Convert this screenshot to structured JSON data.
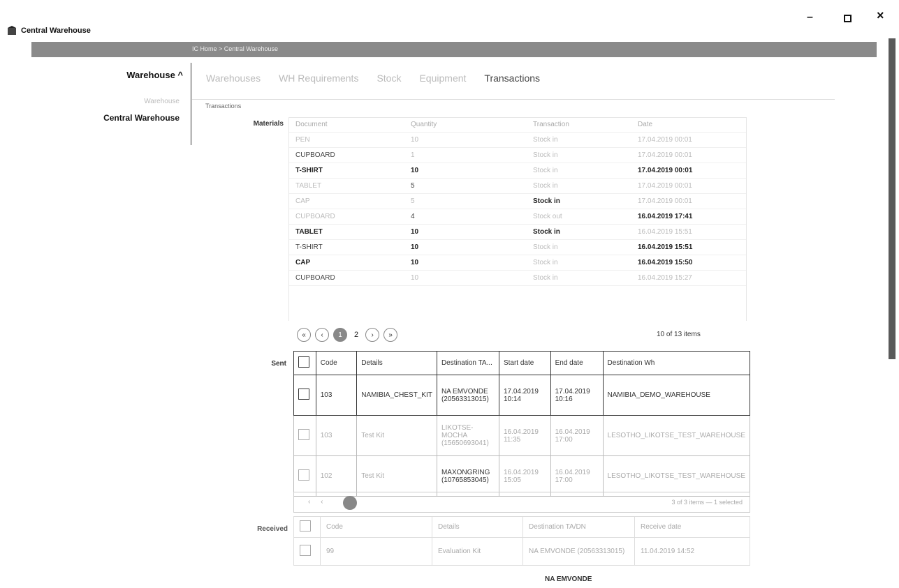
{
  "window": {
    "title": "Central Warehouse",
    "min_icon": "minimize-icon",
    "max_icon": "maximize-icon",
    "close_icon": "close-icon"
  },
  "breadcrumb": "IC Home > Central Warehouse",
  "nav": {
    "title": "Warehouse ^",
    "sub": "Warehouse",
    "item": "Central Warehouse"
  },
  "tabs": [
    "Warehouses",
    "WH Requirements",
    "Stock",
    "Equipment",
    "Transactions"
  ],
  "section_label": "Transactions",
  "materials": {
    "label": "Materials",
    "headers": [
      "Document",
      "Quantity",
      "Transaction",
      "Date"
    ],
    "rows": [
      [
        "PEN",
        "10",
        "Stock in",
        "17.04.2019 00:01"
      ],
      [
        "CUPBOARD",
        "1",
        "Stock in",
        "17.04.2019 00:01"
      ],
      [
        "T-SHIRT",
        "10",
        "Stock in",
        "17.04.2019 00:01"
      ],
      [
        "TABLET",
        "5",
        "Stock in",
        "17.04.2019 00:01"
      ],
      [
        "CAP",
        "5",
        "Stock in",
        "17.04.2019 00:01"
      ],
      [
        "CUPBOARD",
        "4",
        "Stock out",
        "16.04.2019 17:41"
      ],
      [
        "TABLET",
        "10",
        "Stock in",
        "16.04.2019 15:51"
      ],
      [
        "T-SHIRT",
        "10",
        "Stock in",
        "16.04.2019 15:51"
      ],
      [
        "CAP",
        "10",
        "Stock in",
        "16.04.2019 15:50"
      ],
      [
        "CUPBOARD",
        "10",
        "Stock in",
        "16.04.2019 15:27"
      ]
    ],
    "pager": {
      "page": "1",
      "next_page": "2",
      "info": "10 of 13 items"
    }
  },
  "sent": {
    "label": "Sent",
    "headers": [
      "Code",
      "Details",
      "Destination TA...",
      "Start date",
      "End date",
      "Destination Wh"
    ],
    "rows": [
      [
        "103",
        "NAMIBIA_CHEST_KIT",
        "NA EMVONDE (20563313015)",
        "17.04.2019 10:14",
        "17.04.2019 10:16",
        "NAMIBIA_DEMO_WAREHOUSE"
      ],
      [
        "103",
        "Test Kit",
        "LIKOTSE-MOCHA (15650693041)",
        "16.04.2019 11:35",
        "16.04.2019 17:00",
        "LESOTHO_LIKOTSE_TEST_WAREHOUSE"
      ],
      [
        "102",
        "Test Kit",
        "MAXONGRING (10765853045)",
        "16.04.2019 15:05",
        "16.04.2019 17:00",
        "LESOTHO_LIKOTSE_TEST_WAREHOUSE"
      ]
    ],
    "pager_info": "3 of 3 items — 1 selected"
  },
  "received": {
    "label": "Received",
    "headers": [
      "Code",
      "Details",
      "Destination TA/DN",
      "Receive date"
    ],
    "row": [
      "99",
      "Evaluation Kit",
      "NA EMVONDE (20563313015)",
      "11.04.2019 14:52"
    ],
    "next_row_dest": "NA EMVONDE"
  }
}
